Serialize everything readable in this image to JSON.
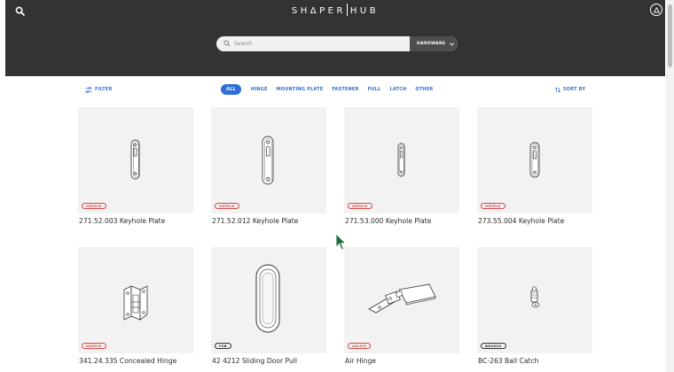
{
  "header": {
    "logo": "SHΔPER",
    "logo_suffix": "HUB",
    "search_placeholder": "Search",
    "hardware_select": "HARDWARE",
    "colors": {
      "header_bg": "#333333",
      "accent": "#2f6ed8"
    }
  },
  "toolbar": {
    "filter_label": "FILTER",
    "sort_label": "SORT BY",
    "categories": [
      "ALL",
      "HINGE",
      "MOUNTING PLATE",
      "FASTENER",
      "PULL",
      "LATCH",
      "OTHER"
    ],
    "active_category": "ALL"
  },
  "products": [
    {
      "title": "271.52.003 Keyhole Plate",
      "brand": "HÄFELE"
    },
    {
      "title": "271.52.012 Keyhole Plate",
      "brand": "HÄFELE"
    },
    {
      "title": "271.53.000 Keyhole Plate",
      "brand": "HÄFELE"
    },
    {
      "title": "273.55.004 Keyhole Plate",
      "brand": "HÄFELE"
    },
    {
      "title": "341.24.335 Concealed Hinge",
      "brand": "HÄFELE"
    },
    {
      "title": "42 4212 Sliding Door Pull",
      "brand": "FSB"
    },
    {
      "title": "Air Hinge",
      "brand": "SALICE"
    },
    {
      "title": "BC-263 Ball Catch",
      "brand": "BRUSSO"
    }
  ]
}
